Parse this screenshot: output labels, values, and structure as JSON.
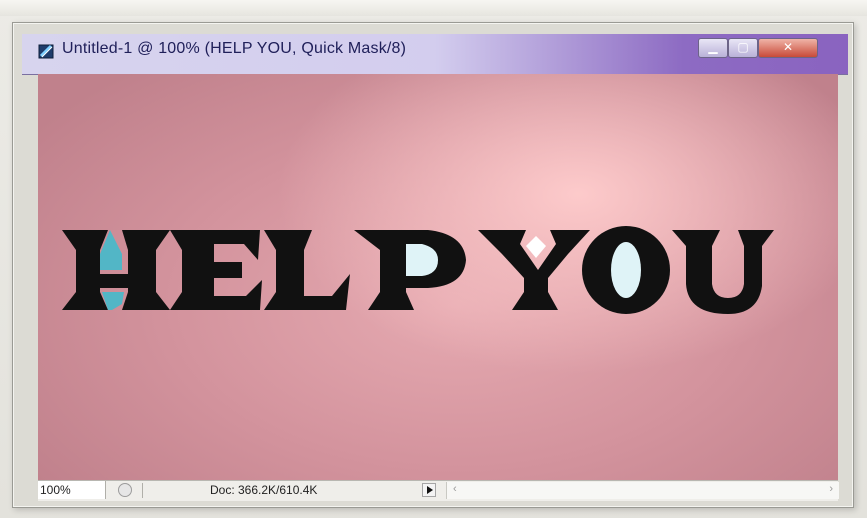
{
  "window": {
    "title": "Untitled-1 @ 100% (HELP YOU, Quick Mask/8)",
    "app_icon": "photoshop-document-icon",
    "controls": [
      "minimize-button",
      "maximize-button",
      "close-button"
    ],
    "title_gradient_colors": [
      "#d7d4ee",
      "#8a63c0"
    ],
    "close_color": "#c84a38"
  },
  "canvas": {
    "text": "HELP YOU",
    "text_color": "#111111",
    "background_colors": [
      "#ffcdcd",
      "#d3939d"
    ],
    "highlight_colors": [
      "#52b6c6",
      "#dff3f7",
      "#ffffff"
    ]
  },
  "statusbar": {
    "zoom": "100%",
    "doc_info": "Doc: 366.2K/610.4K",
    "menu_arrow_icon": "triangle-right-icon",
    "scroll_left_icon": "scroll-left-arrow-icon",
    "scroll_right_icon": "scroll-right-arrow-icon"
  }
}
